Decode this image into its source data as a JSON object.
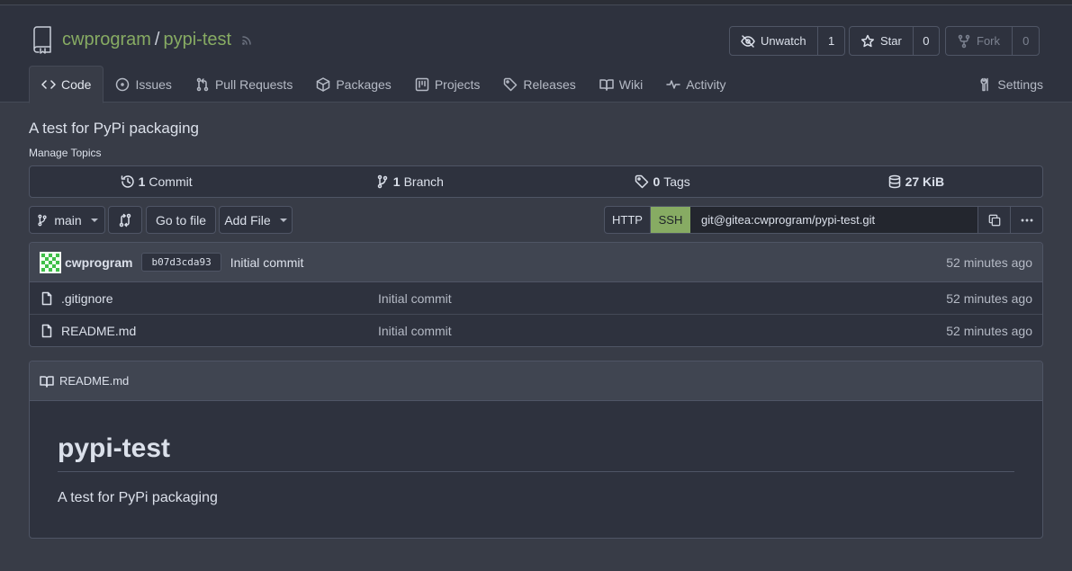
{
  "repo": {
    "owner": "cwprogram",
    "separator": "/",
    "name": "pypi-test",
    "description": "A test for PyPi packaging",
    "manage_topics": "Manage Topics"
  },
  "actions": {
    "unwatch": {
      "label": "Unwatch",
      "count": "1"
    },
    "star": {
      "label": "Star",
      "count": "0"
    },
    "fork": {
      "label": "Fork",
      "count": "0"
    }
  },
  "tabs": [
    {
      "label": "Code",
      "icon": "code-icon"
    },
    {
      "label": "Issues",
      "icon": "issue-icon"
    },
    {
      "label": "Pull Requests",
      "icon": "pull-request-icon"
    },
    {
      "label": "Packages",
      "icon": "package-icon"
    },
    {
      "label": "Projects",
      "icon": "project-icon"
    },
    {
      "label": "Releases",
      "icon": "tag-icon"
    },
    {
      "label": "Wiki",
      "icon": "book-icon"
    },
    {
      "label": "Activity",
      "icon": "pulse-icon"
    }
  ],
  "settings_label": "Settings",
  "stats": {
    "commits": {
      "count": "1",
      "label": "Commit"
    },
    "branches": {
      "count": "1",
      "label": "Branch"
    },
    "tags": {
      "count": "0",
      "label": "Tags"
    },
    "size": {
      "count": "27 KiB"
    }
  },
  "toolbar": {
    "branch": "main",
    "go_to_file": "Go to file",
    "add_file": "Add File"
  },
  "clone": {
    "http": "HTTP",
    "ssh": "SSH",
    "url": "git@gitea:cwprogram/pypi-test.git"
  },
  "latest_commit": {
    "author": "cwprogram",
    "sha": "b07d3cda93",
    "message": "Initial commit",
    "age": "52 minutes ago"
  },
  "files": [
    {
      "name": ".gitignore",
      "message": "Initial commit",
      "age": "52 minutes ago"
    },
    {
      "name": "README.md",
      "message": "Initial commit",
      "age": "52 minutes ago"
    }
  ],
  "readme": {
    "filename": "README.md",
    "heading": "pypi-test",
    "text": "A test for PyPi packaging"
  },
  "colors": {
    "accent": "#87ab63",
    "background": "#383c47",
    "header": "#2e323e"
  }
}
